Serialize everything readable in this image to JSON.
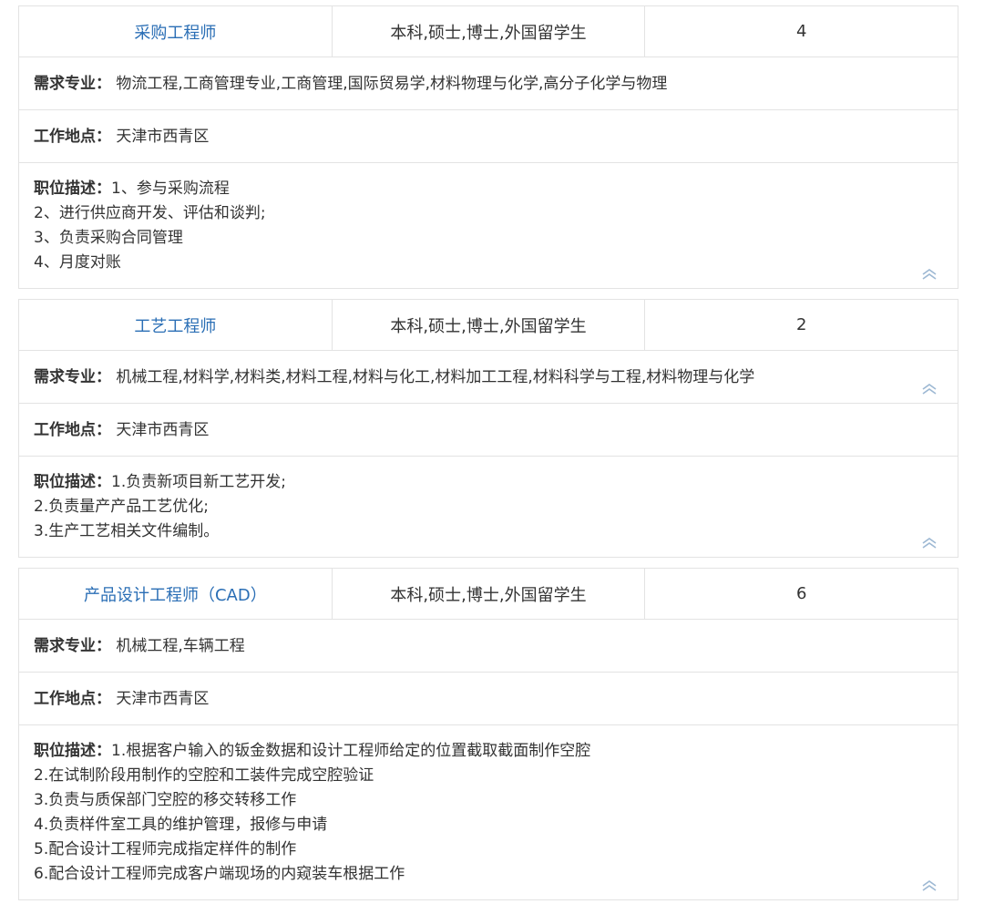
{
  "labels": {
    "major": "需求专业：",
    "location": "工作地点：",
    "description": "职位描述："
  },
  "icons": {
    "collapse": "double-chevron-up-icon"
  },
  "colors": {
    "title_link": "#2a6eb5",
    "border": "#e3e3e3",
    "icon": "#9db8d3"
  },
  "jobs": [
    {
      "title": "采购工程师",
      "education": "本科,硕士,博士,外国留学生",
      "headcount": "4",
      "major": "物流工程,工商管理专业,工商管理,国际贸易学,材料物理与化学,高分子化学与物理",
      "location": "天津市西青区",
      "description": "1、参与采购流程\n2、进行供应商开发、评估和谈判;\n3、负责采购合同管理\n4、月度对账"
    },
    {
      "title": "工艺工程师",
      "education": "本科,硕士,博士,外国留学生",
      "headcount": "2",
      "major": "机械工程,材料学,材料类,材料工程,材料与化工,材料加工工程,材料科学与工程,材料物理与化学",
      "location": "天津市西青区",
      "description": "1.负责新项目新工艺开发;\n2.负责量产产品工艺优化;\n3.生产工艺相关文件编制。"
    },
    {
      "title": "产品设计工程师（CAD）",
      "education": "本科,硕士,博士,外国留学生",
      "headcount": "6",
      "major": "机械工程,车辆工程",
      "location": "天津市西青区",
      "description": "1.根据客户输入的钣金数据和设计工程师给定的位置截取截面制作空腔\n2.在试制阶段用制作的空腔和工装件完成空腔验证\n3.负责与质保部门空腔的移交转移工作\n4.负责样件室工具的维护管理，报修与申请\n5.配合设计工程师完成指定样件的制作\n6.配合设计工程师完成客户端现场的内窥装车根据工作"
    }
  ]
}
